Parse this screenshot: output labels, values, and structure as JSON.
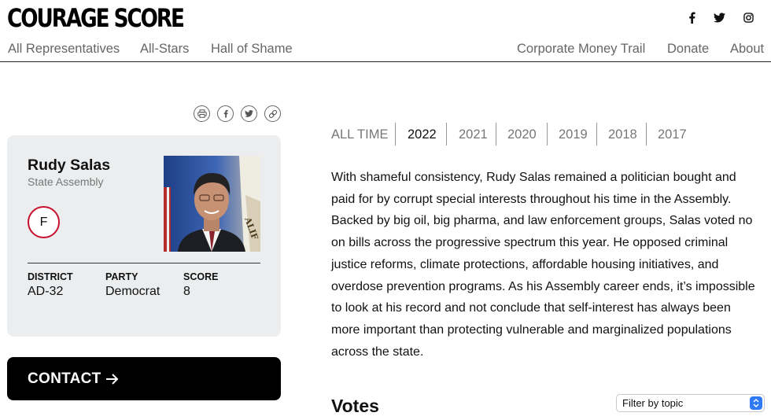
{
  "site": {
    "logo": "COURAGE SCORE"
  },
  "social": [
    "facebook-icon",
    "twitter-icon",
    "instagram-icon"
  ],
  "nav": {
    "left": [
      "All Representatives",
      "All-Stars",
      "Hall of Shame"
    ],
    "right": [
      "Corporate Money Trail",
      "Donate",
      "About"
    ]
  },
  "share": [
    "print-icon",
    "facebook-icon",
    "twitter-icon",
    "link-icon"
  ],
  "rep": {
    "name": "Rudy Salas",
    "chamber": "State Assembly",
    "grade": "F",
    "stats": [
      {
        "label": "DISTRICT",
        "value": "AD-32"
      },
      {
        "label": "PARTY",
        "value": "Democrat"
      },
      {
        "label": "SCORE",
        "value": "8"
      }
    ]
  },
  "contact": {
    "label": "CONTACT"
  },
  "years": {
    "tabs": [
      "ALL TIME",
      "2022",
      "2021",
      "2020",
      "2019",
      "2018",
      "2017"
    ],
    "active": "2022"
  },
  "description": "With shameful consistency, Rudy Salas remained a politician bought and paid for by corrupt special interests throughout his time in the Assembly. Backed by big oil, big pharma, and law enforcement groups, Salas voted no on bills across the progressive spectrum this year. He opposed criminal justice reforms, climate protections, affordable housing initiatives, and overdose prevention programs. As his Assembly career ends, it’s impossible to look at his record and not conclude that self-interest has always been more important than protecting vulnerable and marginalized populations across the state.",
  "votes": {
    "title": "Votes",
    "filter_value": "Filter by topic"
  },
  "colors": {
    "grade_ring": "#c8102e",
    "card_bg": "#ebedef",
    "contact_bg": "#000000",
    "select_accent": "#2f7bf5"
  }
}
